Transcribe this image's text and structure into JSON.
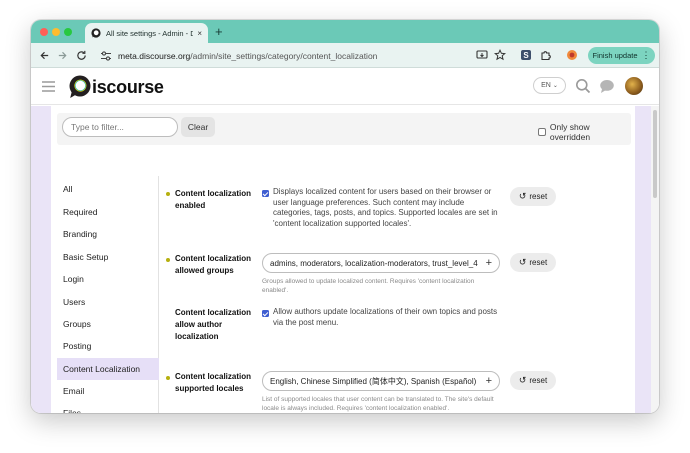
{
  "browser": {
    "tab_title": "All site settings - Admin - Discourse",
    "tab_close": "×",
    "new_tab": "+",
    "url_host": "meta.discourse.org",
    "url_path": "/admin/site_settings/category/content_localization",
    "finish_update": "Finish update",
    "kebab": "⋮",
    "toolbar_icons": [
      "back-arrow-icon",
      "forward-arrow-icon",
      "reload-icon",
      "tune-icon",
      "install-app-icon",
      "bookmark-star-icon",
      "extension-s-icon",
      "puzzle-extension-icon",
      "profile-icon"
    ]
  },
  "site": {
    "logo_text": "iscourse",
    "language": "EN",
    "language_caret": "⌄",
    "icons": [
      "hamburger-icon",
      "search-icon",
      "chat-icon"
    ]
  },
  "filter": {
    "placeholder": "Type to filter...",
    "clear_label": "Clear",
    "only_overridden_label": "Only show overridden"
  },
  "nav": {
    "items": [
      {
        "label": "All"
      },
      {
        "label": "Required"
      },
      {
        "label": "Branding"
      },
      {
        "label": "Basic Setup"
      },
      {
        "label": "Login"
      },
      {
        "label": "Users"
      },
      {
        "label": "Groups"
      },
      {
        "label": "Posting"
      },
      {
        "label": "Content Localization",
        "active": true
      },
      {
        "label": "Email"
      },
      {
        "label": "Files"
      }
    ]
  },
  "settings": [
    {
      "name": "Content localization enabled",
      "type": "bool",
      "checked": true,
      "description": "Displays localized content for users based on their browser or user language preferences. Such content may include categories, tags, posts, and topics. Supported locales are set in 'content localization supported locales'.",
      "reset_label": "reset"
    },
    {
      "name": "Content localization allowed groups",
      "type": "list",
      "value": "admins, moderators, localization-moderators, trust_level_4",
      "plus": "+",
      "hint": "Groups allowed to update localized content. Requires 'content localization enabled'.",
      "reset_label": "reset"
    },
    {
      "name": "Content localization allow author localization",
      "type": "bool",
      "checked": true,
      "description": "Allow authors update localizations of their own topics and posts via the post menu."
    },
    {
      "name": "Content localization supported locales",
      "type": "list",
      "value": "English, Chinese Simplified (简体中文), Spanish (Español)",
      "plus": "+",
      "hint": "List of supported locales that user content can be translated to. The site's default locale is always included. Requires 'content localization enabled'.",
      "reset_label": "reset"
    }
  ],
  "reset_icon": "↺",
  "colors": {
    "tab_strip": "#6bc9b7",
    "finish_button": "#7cd4c0",
    "active_nav": "#e6dff7",
    "side_stripe": "#eae4f7",
    "checkbox": "#3f5ed1",
    "bullet": "#b6b00f"
  }
}
